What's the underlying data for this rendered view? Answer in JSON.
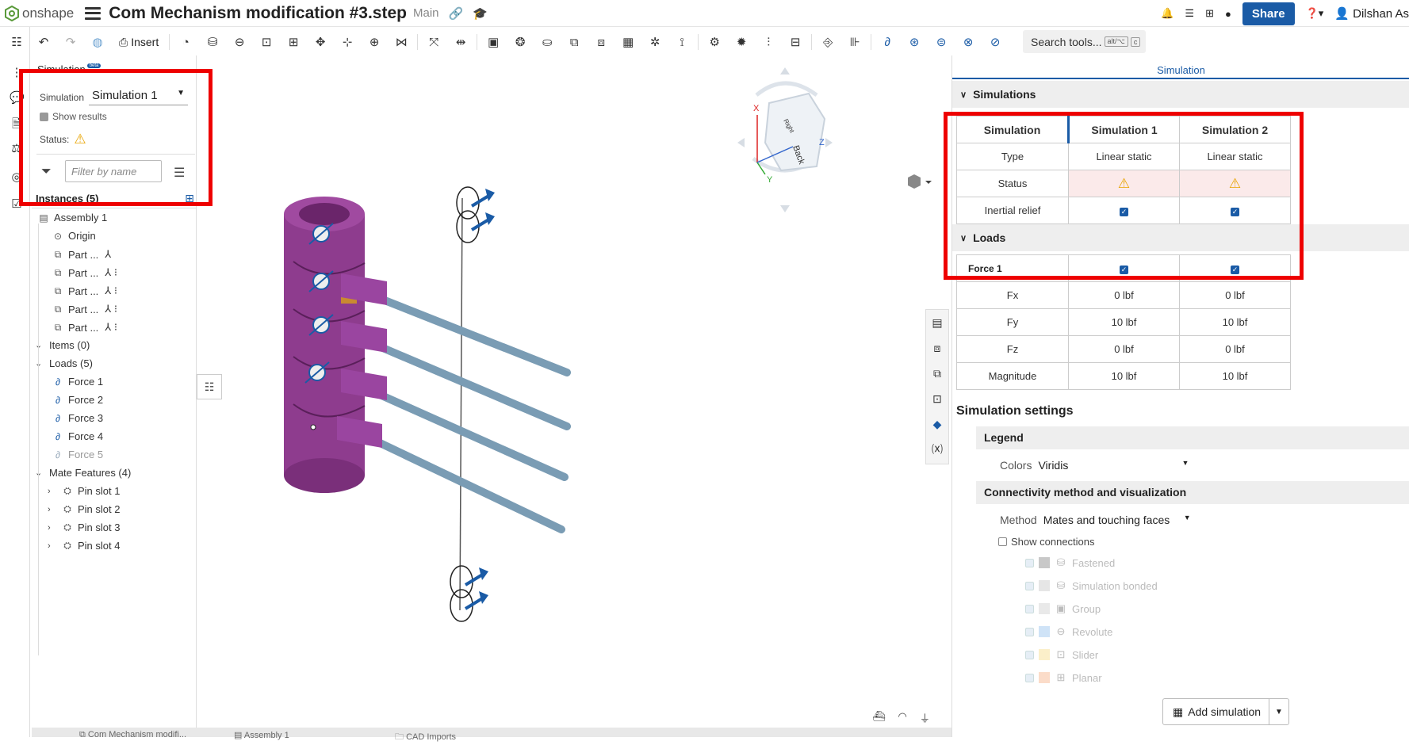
{
  "app": {
    "name": "onshape",
    "doc_title": "Com Mechanism modification #3.step",
    "branch": "Main"
  },
  "topbar": {
    "share_label": "Share",
    "user": "Dilshan As"
  },
  "toolbar": {
    "insert_label": "Insert",
    "search_label": "Search tools...",
    "search_kbd1": "alt/⌥",
    "search_kbd2": "c"
  },
  "left": {
    "title": "Simulation",
    "beta": "beta",
    "sim_label": "Simulation",
    "sim_value": "Simulation 1",
    "show_results": "Show results",
    "status_label": "Status:",
    "filter_placeholder": "Filter by name",
    "instances": "Instances (5)",
    "tree": [
      {
        "label": "Assembly 1"
      },
      {
        "label": "Origin"
      },
      {
        "label": "Part ..."
      },
      {
        "label": "Part ..."
      },
      {
        "label": "Part ..."
      },
      {
        "label": "Part ..."
      },
      {
        "label": "Part ..."
      },
      {
        "label": "Items (0)"
      },
      {
        "label": "Loads (5)"
      },
      {
        "label": "Force 1"
      },
      {
        "label": "Force 2"
      },
      {
        "label": "Force 3"
      },
      {
        "label": "Force 4"
      },
      {
        "label": "Force 5"
      },
      {
        "label": "Mate Features (4)"
      },
      {
        "label": "Pin slot 1"
      },
      {
        "label": "Pin slot 2"
      },
      {
        "label": "Pin slot 3"
      },
      {
        "label": "Pin slot 4"
      }
    ]
  },
  "viewcube": {
    "x": "X",
    "y": "Y",
    "z": "Z",
    "face1": "Back",
    "face2": "Right"
  },
  "right": {
    "header": "Simulation",
    "simulations_band": "Simulations",
    "col_head": "Simulation",
    "sim1": "Simulation 1",
    "sim2": "Simulation 2",
    "type_label": "Type",
    "type1": "Linear static",
    "type2": "Linear static",
    "status_label": "Status",
    "inertial_label": "Inertial relief",
    "loads_band": "Loads",
    "force1": "Force 1",
    "fx": "Fx",
    "fy": "Fy",
    "fz": "Fz",
    "mag": "Magnitude",
    "fx1": "0 lbf",
    "fx2": "0 lbf",
    "fy1": "10 lbf",
    "fy2": "10 lbf",
    "fz1": "0 lbf",
    "fz2": "0 lbf",
    "mag1": "10 lbf",
    "mag2": "10 lbf",
    "settings_title": "Simulation settings",
    "legend_h": "Legend",
    "colors_label": "Colors",
    "colors_value": "Viridis",
    "conn_h": "Connectivity method and visualization",
    "method_label": "Method",
    "method_value": "Mates and touching faces",
    "show_conn": "Show connections",
    "conn_items": [
      {
        "label": "Fastened",
        "color": "#c8c8c8"
      },
      {
        "label": "Simulation bonded",
        "color": "#e6e6e6"
      },
      {
        "label": "Group",
        "color": "#e9e9e9"
      },
      {
        "label": "Revolute",
        "color": "#cfe3f7"
      },
      {
        "label": "Slider",
        "color": "#fbefc9"
      },
      {
        "label": "Planar",
        "color": "#fbdcc9"
      }
    ],
    "add_sim": "Add simulation"
  },
  "bottom_tabs": {
    "t1": "Com Mechanism modifi...",
    "t2": "Assembly 1",
    "t3": "CAD Imports"
  },
  "colors": {
    "accent": "#1a5ba6",
    "highlight": "#e00000",
    "part": "#8e3c8e",
    "rod": "#7a9cb4"
  }
}
